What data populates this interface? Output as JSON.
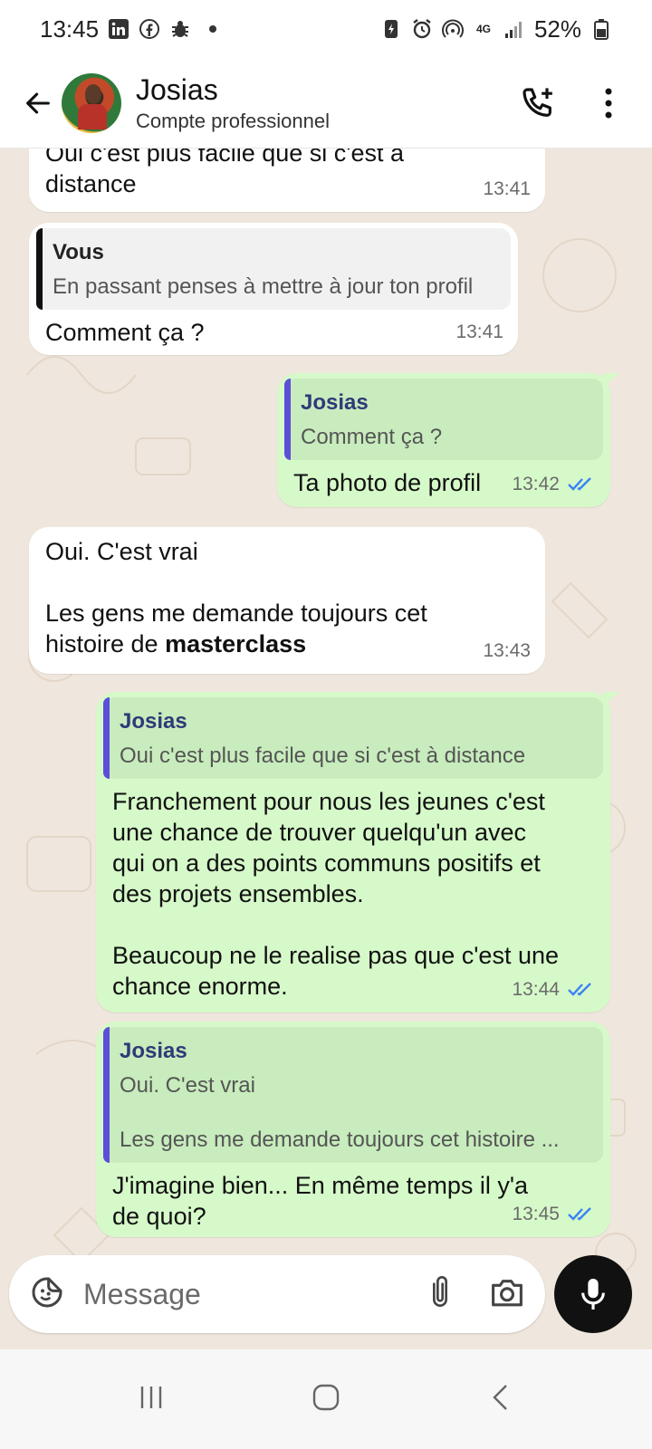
{
  "status_bar": {
    "time": "13:45",
    "battery": "52%",
    "network": "4G"
  },
  "header": {
    "name": "Josias",
    "subtitle": "Compte professionnel"
  },
  "messages": [
    {
      "text": "Oui c'est plus facile que si c'est à distance",
      "time": "13:41"
    },
    {
      "quote_author": "Vous",
      "quote_text": "En passant penses à mettre à jour ton profil",
      "text": "Comment ça ?",
      "time": "13:41"
    },
    {
      "quote_author": "Josias",
      "quote_text": "Comment ça ?",
      "text": "Ta photo de profil",
      "time": "13:42"
    },
    {
      "text": "Oui. C'est vrai\n\nLes gens me demande toujours cet\nhistoire de ",
      "bold": "masterclass",
      "time": "13:43"
    },
    {
      "quote_author": "Josias",
      "quote_text": "Oui c'est plus facile que si c'est à distance",
      "text": "Franchement pour nous les jeunes c'est\nune chance de trouver quelqu'un avec\nqui on a des points communs positifs et\ndes projets ensembles.\n\nBeaucoup ne le realise pas que c'est une\nchance enorme.",
      "time": "13:44"
    },
    {
      "quote_author": "Josias",
      "quote_text": "Oui. C'est vrai\n\nLes gens me demande toujours cet histoire ...",
      "text": "J'imagine bien... En même temps il y'a\nde quoi?",
      "time": "13:45"
    }
  ],
  "input": {
    "placeholder": "Message"
  },
  "colors": {
    "outgoing_bubble": "#d6f9c9",
    "incoming_bubble": "#ffffff",
    "chat_background": "#efe7dd",
    "read_ticks": "#3b82f6"
  }
}
